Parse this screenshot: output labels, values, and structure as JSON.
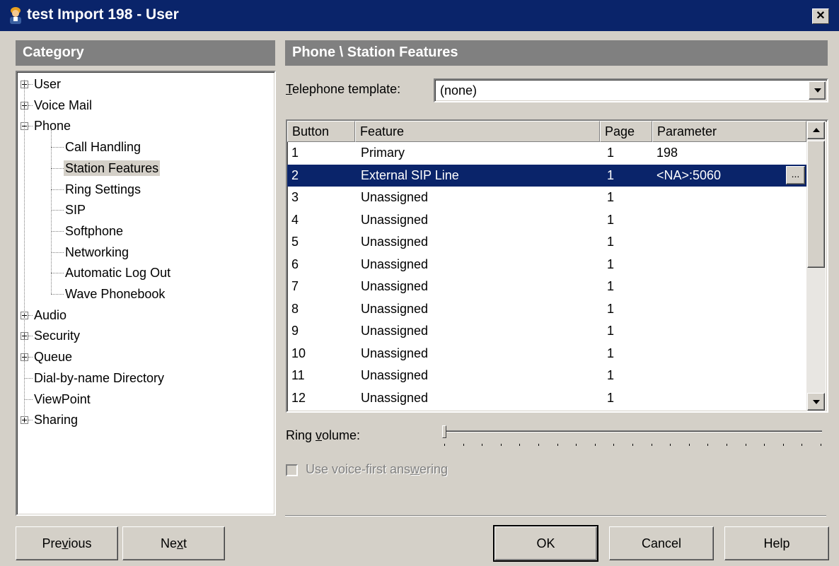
{
  "window": {
    "title": "test Import 198 - User",
    "close_label": "✕"
  },
  "category": {
    "header": "Category",
    "tree": [
      {
        "label": "User",
        "expander": "plus",
        "level": 0
      },
      {
        "label": "Voice Mail",
        "expander": "plus",
        "level": 0
      },
      {
        "label": "Phone",
        "expander": "minus",
        "level": 0
      },
      {
        "label": "Call Handling",
        "level": 1
      },
      {
        "label": "Station Features",
        "level": 1,
        "selected": true
      },
      {
        "label": "Ring Settings",
        "level": 1
      },
      {
        "label": "SIP",
        "level": 1
      },
      {
        "label": "Softphone",
        "level": 1
      },
      {
        "label": "Networking",
        "level": 1
      },
      {
        "label": "Automatic Log Out",
        "level": 1
      },
      {
        "label": "Wave Phonebook",
        "level": 1
      },
      {
        "label": "Audio",
        "expander": "plus",
        "level": 0
      },
      {
        "label": "Security",
        "expander": "plus",
        "level": 0
      },
      {
        "label": "Queue",
        "expander": "plus",
        "level": 0
      },
      {
        "label": "Dial-by-name Directory",
        "level": 0
      },
      {
        "label": "ViewPoint",
        "level": 0
      },
      {
        "label": "Sharing",
        "expander": "plus",
        "level": 0
      }
    ]
  },
  "main": {
    "header": "Phone \\ Station Features",
    "template_label_mnemonic": "T",
    "template_label_rest": "elephone template:",
    "template_value": "(none)",
    "columns": [
      "Button",
      "Feature",
      "Page",
      "Parameter"
    ],
    "rows": [
      {
        "button": "1",
        "feature": "Primary",
        "page": "1",
        "parameter": "198"
      },
      {
        "button": "2",
        "feature": "External SIP Line",
        "page": "1",
        "parameter": "<NA>:5060",
        "selected": true
      },
      {
        "button": "3",
        "feature": "Unassigned",
        "page": "1",
        "parameter": ""
      },
      {
        "button": "4",
        "feature": "Unassigned",
        "page": "1",
        "parameter": ""
      },
      {
        "button": "5",
        "feature": "Unassigned",
        "page": "1",
        "parameter": ""
      },
      {
        "button": "6",
        "feature": "Unassigned",
        "page": "1",
        "parameter": ""
      },
      {
        "button": "7",
        "feature": "Unassigned",
        "page": "1",
        "parameter": ""
      },
      {
        "button": "8",
        "feature": "Unassigned",
        "page": "1",
        "parameter": ""
      },
      {
        "button": "9",
        "feature": "Unassigned",
        "page": "1",
        "parameter": ""
      },
      {
        "button": "10",
        "feature": "Unassigned",
        "page": "1",
        "parameter": ""
      },
      {
        "button": "11",
        "feature": "Unassigned",
        "page": "1",
        "parameter": ""
      },
      {
        "button": "12",
        "feature": "Unassigned",
        "page": "1",
        "parameter": ""
      }
    ],
    "ellipsis_label": "...",
    "ring_volume_label_a": "Ring ",
    "ring_volume_label_mnemonic": "v",
    "ring_volume_label_b": "olume:",
    "ring_volume_level": 0,
    "voice_first_label_a": "Use voice-first ans",
    "voice_first_label_mnemonic": "w",
    "voice_first_label_b": "ering",
    "voice_first_checked": false,
    "voice_first_enabled": false
  },
  "footer": {
    "previous_a": "Pre",
    "previous_mnemonic": "v",
    "previous_b": "ious",
    "next_a": "Ne",
    "next_mnemonic": "x",
    "next_b": "t",
    "ok": "OK",
    "cancel": "Cancel",
    "help": "Help"
  },
  "colors": {
    "titlebar": "#0a246a",
    "face": "#d4d0c8",
    "header": "#808080",
    "selection": "#0a246a"
  }
}
